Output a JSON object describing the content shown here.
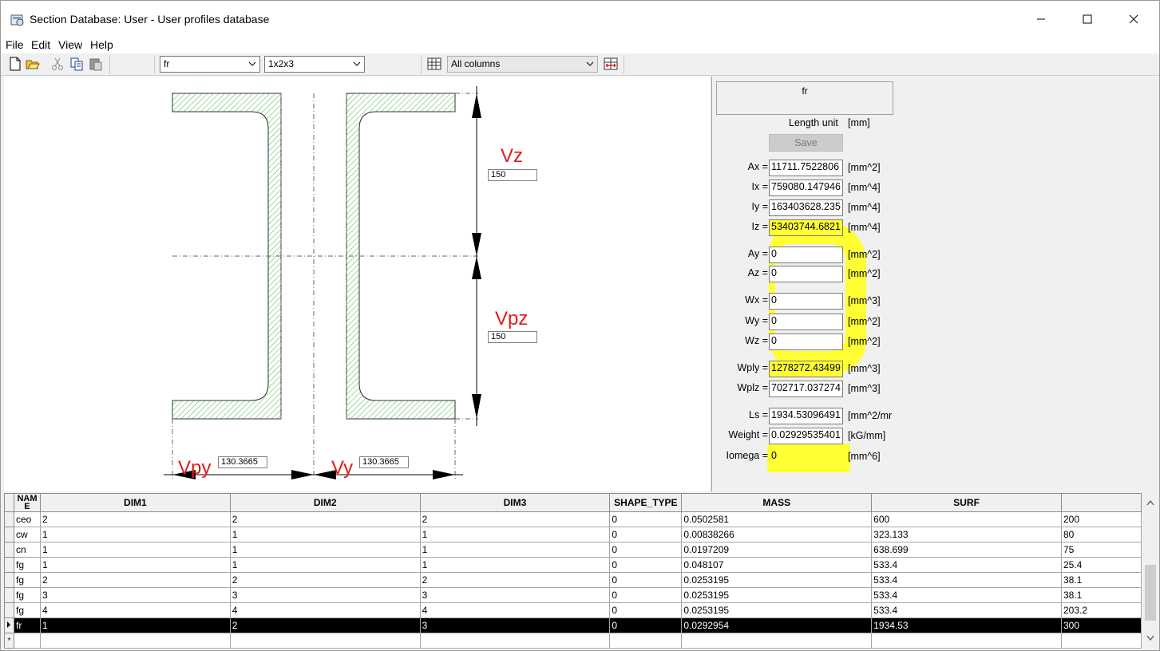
{
  "window": {
    "title": "Section Database: User - User profiles database",
    "controls": [
      "minimize",
      "maximize",
      "close"
    ]
  },
  "menu": [
    "File",
    "Edit",
    "View",
    "Help"
  ],
  "toolbar": {
    "icons": [
      "new-icon",
      "open-icon",
      "cut-icon",
      "copy-icon",
      "paste-icon"
    ],
    "section_combo": "fr",
    "dims_combo": "1x2x3",
    "columns_combo": "All columns"
  },
  "drawing": {
    "vz_label": "Vz",
    "vz_value": "150",
    "vpz_label": "Vpz",
    "vpz_value": "150",
    "vpy_label": "Vpy",
    "vpy_value": "130.3665",
    "vy_label": "Vy",
    "vy_value": "130.3665",
    "hatch_color": "#5cc65c"
  },
  "properties": {
    "name": "fr",
    "length_unit_label": "Length unit",
    "length_unit": "[mm]",
    "save_label": "Save",
    "highlight_color": "#ffff00",
    "rows": [
      {
        "label": "Ax =",
        "value": "11711.7522806",
        "unit": "[mm^2]"
      },
      {
        "label": "Ix =",
        "value": "759080.147946",
        "unit": "[mm^4]"
      },
      {
        "label": "Iy =",
        "value": "163403628.235",
        "unit": "[mm^4]"
      },
      {
        "label": "Iz =",
        "value": "53403744.6821",
        "unit": "[mm^4]"
      },
      {
        "label": "Ay =",
        "value": "0",
        "unit": "[mm^2]"
      },
      {
        "label": "Az =",
        "value": "0",
        "unit": "[mm^2]"
      },
      {
        "label": "Wx =",
        "value": "0",
        "unit": "[mm^3]"
      },
      {
        "label": "Wy =",
        "value": "0",
        "unit": "[mm^2]"
      },
      {
        "label": "Wz =",
        "value": "0",
        "unit": "[mm^2]"
      },
      {
        "label": "Wply =",
        "value": "1278272.43499",
        "unit": "[mm^3]"
      },
      {
        "label": "Wplz =",
        "value": "702717.037274",
        "unit": "[mm^3]"
      },
      {
        "label": "Ls =",
        "value": "1934.53096491",
        "unit": "[mm^2/mr"
      },
      {
        "label": "Weight =",
        "value": "0.02929535401",
        "unit": "[kG/mm]"
      },
      {
        "label": "Iomega =",
        "value": "0",
        "unit": "[mm^6]"
      }
    ]
  },
  "table": {
    "columns": [
      "NAME",
      "DIM1",
      "DIM2",
      "DIM3",
      "SHAPE_TYPE",
      "MASS",
      "SURF",
      ""
    ],
    "rows": [
      [
        "ceo",
        "2",
        "2",
        "2",
        "0",
        "0.0502581",
        "600",
        "200"
      ],
      [
        "cw",
        "1",
        "1",
        "1",
        "0",
        "0.00838266",
        "323.133",
        "80"
      ],
      [
        "cn",
        "1",
        "1",
        "1",
        "0",
        "0.0197209",
        "638.699",
        "75"
      ],
      [
        "fg",
        "1",
        "1",
        "1",
        "0",
        "0.048107",
        "533.4",
        "25.4"
      ],
      [
        "fg",
        "2",
        "2",
        "2",
        "0",
        "0.0253195",
        "533.4",
        "38.1"
      ],
      [
        "fg",
        "3",
        "3",
        "3",
        "0",
        "0.0253195",
        "533.4",
        "38.1"
      ],
      [
        "fg",
        "4",
        "4",
        "4",
        "0",
        "0.0253195",
        "533.4",
        "203.2"
      ],
      [
        "fr",
        "1",
        "2",
        "3",
        "0",
        "0.0292954",
        "1934.53",
        "300"
      ],
      [
        "",
        "",
        "",
        "",
        "",
        "",
        "",
        ""
      ]
    ],
    "selected_row": 7,
    "new_row_marker": "*"
  }
}
